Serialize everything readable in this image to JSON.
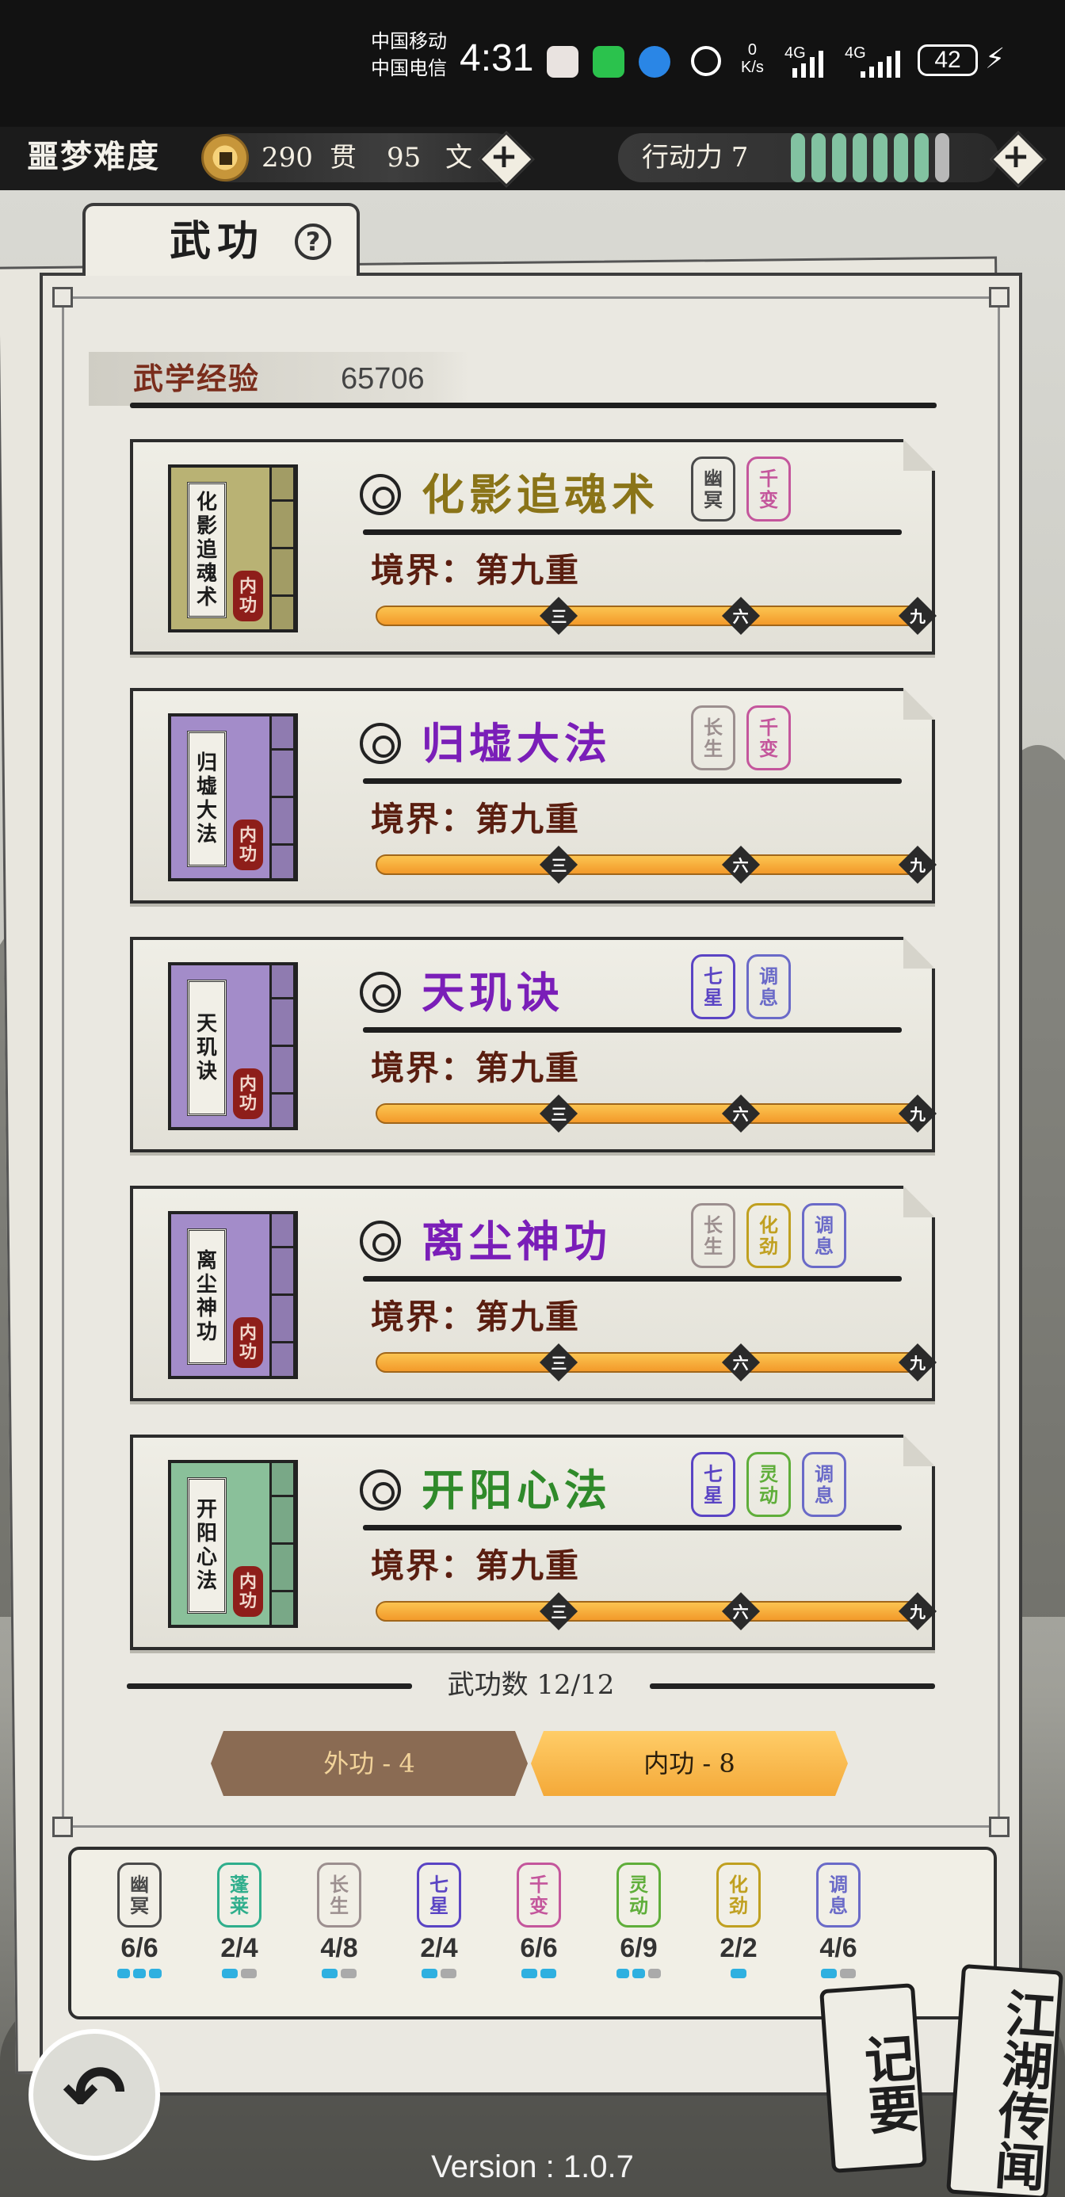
{
  "status_bar": {
    "carrier1": "中国移动",
    "carrier2": "中国电信",
    "time": "4:31",
    "net_speed_value": "0",
    "net_speed_unit": "K/s",
    "sig1": "4G",
    "sig2": "4G",
    "battery": "42"
  },
  "top_bar": {
    "difficulty": "噩梦难度",
    "coins": {
      "guan_value": "290",
      "guan_unit": "贯",
      "wen_value": "95",
      "wen_unit": "文"
    },
    "stamina": {
      "label": "行动力 7",
      "filled": 7,
      "total": 8
    },
    "plus": "+"
  },
  "tab": {
    "title": "武功",
    "help": "?"
  },
  "experience": {
    "label": "武学经验",
    "value": "65706"
  },
  "skills": [
    {
      "name": "化影追魂术",
      "book_title": "化影追魂术",
      "type": "内功",
      "realm": "境界：第九重",
      "progress": 1.0,
      "color": "#8a7418",
      "book_color": "#b9b274",
      "tags": [
        {
          "text": "幽冥",
          "color": "#4a4a4a"
        },
        {
          "text": "千变",
          "color": "#c4569c"
        }
      ]
    },
    {
      "name": "归墟大法",
      "book_title": "归墟大法",
      "type": "内功",
      "realm": "境界：第九重",
      "progress": 1.0,
      "color": "#7a1eb8",
      "book_color": "#a38cc9",
      "tags": [
        {
          "text": "长生",
          "color": "#9c8f8f"
        },
        {
          "text": "千变",
          "color": "#c4569c"
        }
      ]
    },
    {
      "name": "天玑诀",
      "book_title": "天玑诀",
      "type": "内功",
      "realm": "境界：第九重",
      "progress": 1.0,
      "color": "#7a1eb8",
      "book_color": "#a38cc9",
      "tags": [
        {
          "text": "七星",
          "color": "#5a44c4"
        },
        {
          "text": "调息",
          "color": "#6a6ac8"
        }
      ]
    },
    {
      "name": "离尘神功",
      "book_title": "离尘神功",
      "type": "内功",
      "realm": "境界：第九重",
      "progress": 1.0,
      "color": "#7a1eb8",
      "book_color": "#a38cc9",
      "tags": [
        {
          "text": "长生",
          "color": "#9c8f8f"
        },
        {
          "text": "化劲",
          "color": "#c0a020"
        },
        {
          "text": "调息",
          "color": "#6a6ac8"
        }
      ]
    },
    {
      "name": "开阳心法",
      "book_title": "开阳心法",
      "type": "内功",
      "realm": "境界：第九重",
      "progress": 1.0,
      "color": "#2f8a2a",
      "book_color": "#8ac09a",
      "tags": [
        {
          "text": "七星",
          "color": "#5a44c4"
        },
        {
          "text": "灵动",
          "color": "#5fae3a"
        },
        {
          "text": "调息",
          "color": "#6a6ac8"
        }
      ]
    }
  ],
  "progress_marks": [
    "三",
    "六",
    "九"
  ],
  "skill_count": "武功数 12/12",
  "buttons": {
    "outer": "外功 - 4",
    "inner": "内功 - 8"
  },
  "summary": [
    {
      "text": "幽冥",
      "color": "#4a4a4a",
      "frac": "6/6",
      "dots": [
        1,
        1,
        1
      ]
    },
    {
      "text": "蓬莱",
      "color": "#2fae8c",
      "frac": "2/4",
      "dots": [
        1,
        0
      ]
    },
    {
      "text": "长生",
      "color": "#9c8f8f",
      "frac": "4/8",
      "dots": [
        1,
        0
      ]
    },
    {
      "text": "七星",
      "color": "#5a44c4",
      "frac": "2/4",
      "dots": [
        1,
        0
      ]
    },
    {
      "text": "千变",
      "color": "#c4569c",
      "frac": "6/6",
      "dots": [
        1,
        1
      ]
    },
    {
      "text": "灵动",
      "color": "#5fae3a",
      "frac": "6/9",
      "dots": [
        1,
        1,
        0
      ]
    },
    {
      "text": "化劲",
      "color": "#c0a020",
      "frac": "2/2",
      "dots": [
        1
      ]
    },
    {
      "text": "调息",
      "color": "#6a6ac8",
      "frac": "4/6",
      "dots": [
        1,
        0
      ]
    }
  ],
  "bottom": {
    "back_icon": "back-arrow-icon",
    "memo": "记要",
    "news": "江湖传闻",
    "version": "Version : 1.0.7"
  }
}
